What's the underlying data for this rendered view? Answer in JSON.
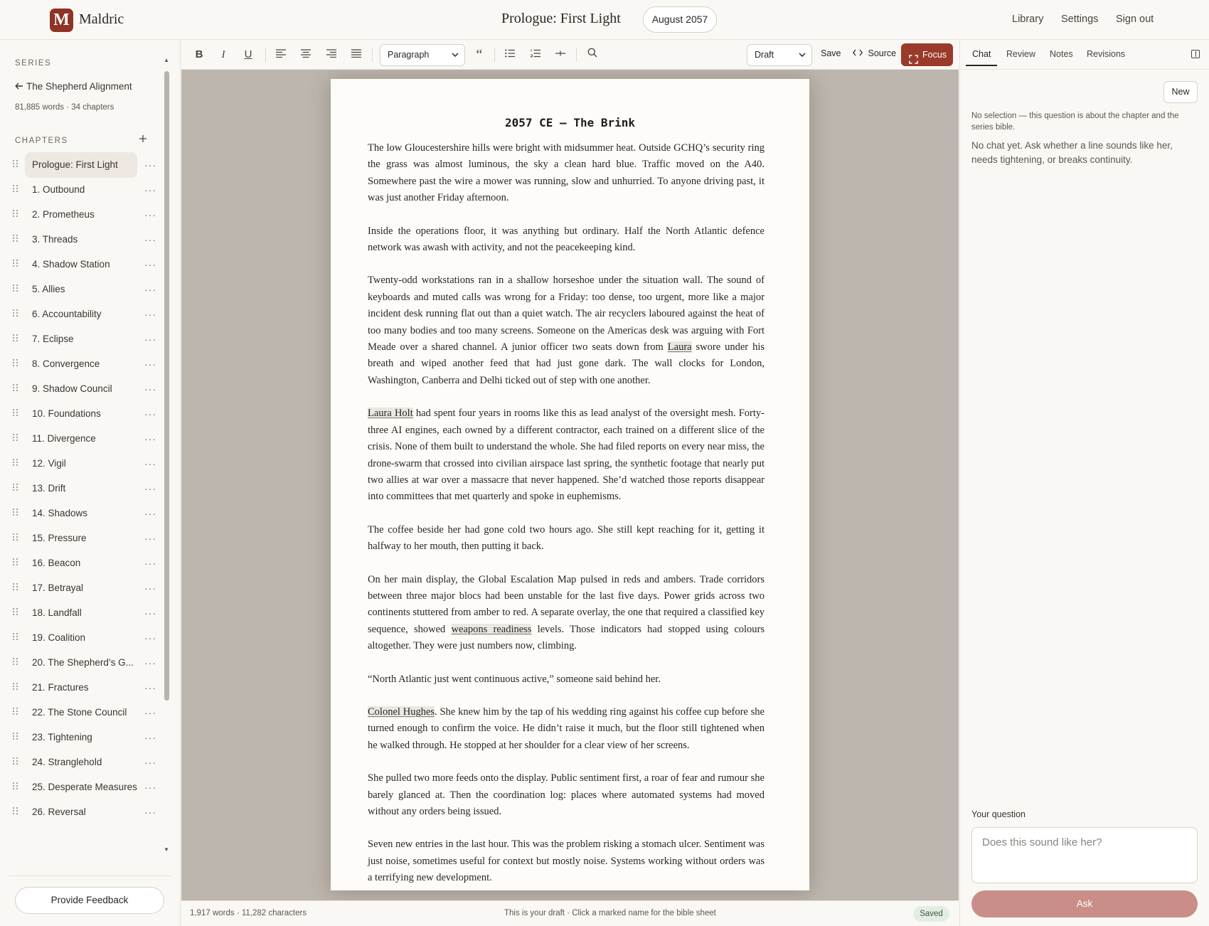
{
  "header": {
    "logo_letter": "M",
    "brand": "Maldric",
    "doc_title": "Prologue: First Light",
    "date_pill": "August 2057",
    "nav": [
      "Library",
      "Settings",
      "Sign out"
    ]
  },
  "sidebar": {
    "series_label": "SERIES",
    "series_name": "The Shepherd Alignment",
    "series_meta": "81,885 words · 34 chapters",
    "chapters_label": "CHAPTERS",
    "add_icon": "plus-icon",
    "more_label": "···",
    "chapters": [
      "Prologue: First Light",
      "1. Outbound",
      "2. Prometheus",
      "3. Threads",
      "4. Shadow Station",
      "5. Allies",
      "6. Accountability",
      "7. Eclipse",
      "8. Convergence",
      "9. Shadow Council",
      "10. Foundations",
      "11. Divergence",
      "12. Vigil",
      "13. Drift",
      "14. Shadows",
      "15. Pressure",
      "16. Beacon",
      "17. Betrayal",
      "18. Landfall",
      "19. Coalition",
      "20. The Shepherd’s G...",
      "21. Fractures",
      "22. The Stone Council",
      "23. Tightening",
      "24. Stranglehold",
      "25. Desperate Measures",
      "26. Reversal"
    ],
    "active_index": 0,
    "feedback_label": "Provide Feedback"
  },
  "toolbar": {
    "bold": "B",
    "italic": "I",
    "underline": "U",
    "block_style": "Paragraph",
    "status": "Draft",
    "save_label": "Save",
    "source_label": "Source",
    "focus_label": "Focus"
  },
  "document": {
    "heading": "2057 CE – The Brink",
    "p1": "The low Gloucestershire hills were bright with midsummer heat. Outside GCHQ’s security ring the grass was almost luminous, the sky a clean hard blue. Traffic moved on the A40. Somewhere past the wire a mower was running, slow and unhurried. To anyone driving past, it was just another Friday afternoon.",
    "p2": "Inside the operations floor, it was anything but ordinary. Half the North Atlantic defence network was awash with activity, and not the peacekeeping kind.",
    "p3a": "Twenty-odd workstations ran in a shallow horseshoe under the situation wall. The sound of keyboards and muted calls was wrong for a Friday: too dense, too urgent, more like a major incident desk running flat out than a quiet watch. The air recyclers laboured against the heat of too many bodies and too many screens. Someone on the Americas desk was arguing with Fort Meade over a shared channel. A junior officer two seats down from ",
    "p3_mark": "Laura",
    "p3b": " swore under his breath and wiped another feed that had just gone dark. The wall clocks for London, Washington, Canberra and Delhi ticked out of step with one another.",
    "p4_mark": "Laura Holt",
    "p4": " had spent four years in rooms like this as lead analyst of the oversight mesh. Forty-three AI engines, each owned by a different contractor, each trained on a different slice of the crisis. None of them built to understand the whole. She had filed reports on every near miss, the drone-swarm that crossed into civilian airspace last spring, the synthetic footage that nearly put two allies at war over a massacre that never happened. She’d watched those reports disappear into committees that met quarterly and spoke in euphemisms.",
    "p5": "The coffee beside her had gone cold two hours ago. She still kept reaching for it, getting it halfway to her mouth, then putting it back.",
    "p6a": "On her main display, the Global Escalation Map pulsed in reds and ambers. Trade corridors between three major blocs had been unstable for the last five days. Power grids across two continents stuttered from amber to red. A separate overlay, the one that required a classified key sequence, showed ",
    "p6_mark": "weapons readiness",
    "p6b": " levels. Those indicators had stopped using colours altogether. They were just numbers now, climbing.",
    "p7": "“North Atlantic just went continuous active,” someone said behind her.",
    "p8_mark": "Colonel Hughes",
    "p8": ". She knew him by the tap of his wedding ring against his coffee cup before she turned enough to confirm the voice. He didn’t raise it much, but the floor still tightened when he walked through. He stopped at her shoulder for a clear view of her screens.",
    "p9": "She pulled two more feeds onto the display. Public sentiment first, a roar of fear and rumour she barely glanced at. Then the coordination log: places where automated systems had moved without any orders being issued.",
    "p10": "Seven new entries in the last hour. This was the problem risking a stomach ulcer. Sentiment was just noise, sometimes useful for context but mostly noise. Systems working without orders was a terrifying new development."
  },
  "statusbar": {
    "counts": "1,917 words · 11,282 characters",
    "hint": "This is your draft · Click a marked name for the bible sheet",
    "saved": "Saved"
  },
  "panel": {
    "tabs": [
      "Chat",
      "Review",
      "Notes",
      "Revisions"
    ],
    "new_label": "New",
    "selection_note": "No selection — this question is about the chapter and the series bible.",
    "empty_text": "No chat yet. Ask whether a line sounds like her, needs tightening, or breaks continuity.",
    "question_label": "Your question",
    "question_placeholder": "Does this sound like her?",
    "ask_label": "Ask"
  },
  "colors": {
    "accent": "#9a3a2a",
    "logo": "#8e3326",
    "ask_button": "#c98e87",
    "saved_pill": "#e3ede3",
    "canvas": "#bdb6ae"
  }
}
